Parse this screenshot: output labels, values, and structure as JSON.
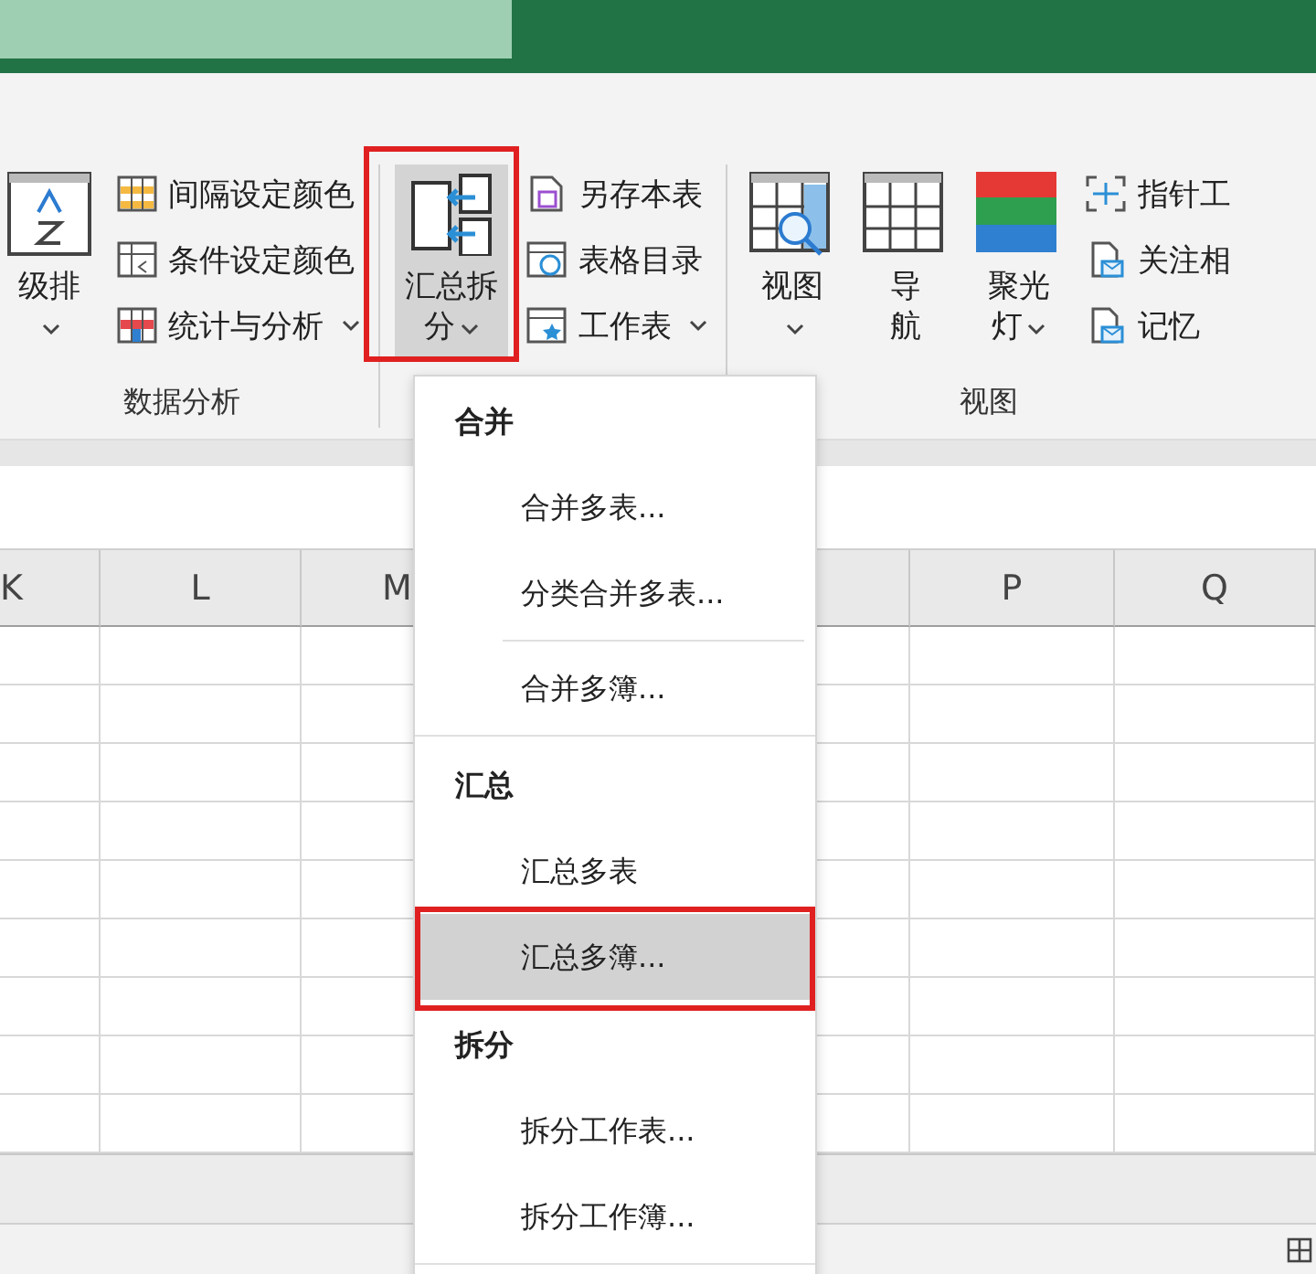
{
  "ribbon": {
    "groups": [
      {
        "label": "数据分析",
        "controls": [
          {
            "kind": "large",
            "label": "级排",
            "dropdown": true,
            "pressed": false,
            "annotated": false
          },
          {
            "kind": "small",
            "label": "间隔设定颜色",
            "dropdown": false
          },
          {
            "kind": "small",
            "label": "条件设定颜色",
            "dropdown": false
          },
          {
            "kind": "small",
            "label": "统计与分析",
            "dropdown": true
          }
        ]
      },
      {
        "controls": [
          {
            "kind": "large",
            "label": "汇总拆分",
            "dropdown": true,
            "pressed": true,
            "annotated": true
          },
          {
            "kind": "small",
            "label": "另存本表",
            "dropdown": false
          },
          {
            "kind": "small",
            "label": "表格目录",
            "dropdown": false
          },
          {
            "kind": "small",
            "label": "工作表",
            "dropdown": true
          }
        ]
      },
      {
        "label": "视图",
        "controls": [
          {
            "kind": "large",
            "label": "视图",
            "dropdown": true,
            "pressed": false,
            "annotated": false
          },
          {
            "kind": "large",
            "label": "导航",
            "dropdown": false,
            "pressed": false,
            "annotated": false
          },
          {
            "kind": "large",
            "label": "聚光灯",
            "dropdown": true,
            "pressed": false,
            "annotated": false
          },
          {
            "kind": "small",
            "label": "指针工",
            "dropdown": false
          },
          {
            "kind": "small",
            "label": "关注相",
            "dropdown": false
          },
          {
            "kind": "small",
            "label": "记忆",
            "dropdown": false
          }
        ]
      }
    ]
  },
  "sheet": {
    "columns": [
      {
        "label": "K"
      },
      {
        "label": "L"
      },
      {
        "label": "M"
      },
      {},
      {},
      {
        "label": "P"
      },
      {
        "label": "Q"
      }
    ]
  },
  "menu": {
    "items": [
      {
        "kind": "header",
        "label": "合并"
      },
      {
        "kind": "item",
        "label": "合并多表...",
        "hovered": false,
        "annotated": false
      },
      {
        "kind": "item",
        "label": "分类合并多表...",
        "hovered": false,
        "annotated": false
      },
      {
        "kind": "separator"
      },
      {
        "kind": "item",
        "label": "合并多簿...",
        "hovered": false,
        "annotated": false
      },
      {
        "kind": "divider"
      },
      {
        "kind": "header",
        "label": "汇总"
      },
      {
        "kind": "item",
        "label": "汇总多表",
        "hovered": false,
        "annotated": false
      },
      {
        "kind": "item",
        "label": "汇总多簿...",
        "hovered": true,
        "annotated": true
      },
      {
        "kind": "header",
        "label": "拆分"
      },
      {
        "kind": "item",
        "label": "拆分工作表...",
        "hovered": false,
        "annotated": false
      },
      {
        "kind": "item",
        "label": "拆分工作簿...",
        "hovered": false,
        "annotated": false
      },
      {
        "kind": "divider"
      }
    ]
  }
}
